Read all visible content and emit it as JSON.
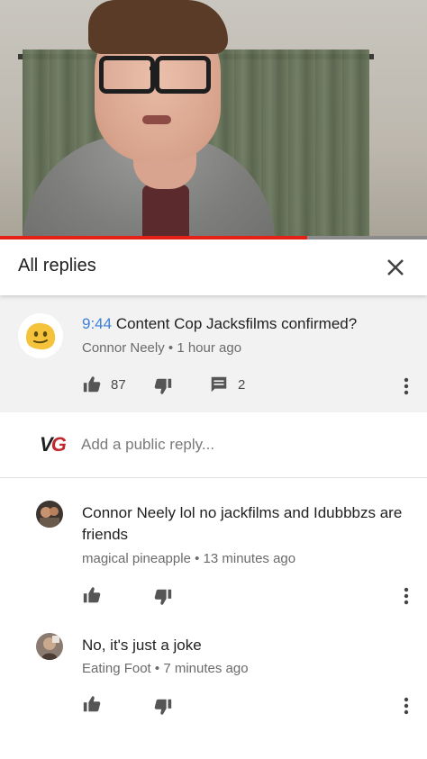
{
  "video": {
    "progress_fraction": 0.72
  },
  "header": {
    "title": "All replies",
    "close_icon": "close-icon"
  },
  "parent_comment": {
    "timestamp": "9:44",
    "text": " Content Cop Jacksfilms confirmed?",
    "author": "Connor Neely",
    "separator": "•",
    "time": "1 hour ago",
    "likes": "87",
    "replies": "2"
  },
  "add_reply": {
    "logo_v": "V",
    "logo_g": "G",
    "placeholder": "Add a public reply..."
  },
  "replies": [
    {
      "text": "Connor Neely lol no jackfilms and Idubbbzs are friends",
      "author": "magical pineapple",
      "separator": "•",
      "time": "13 minutes ago"
    },
    {
      "text": "No, it's just a joke",
      "author": "Eating Foot",
      "separator": "•",
      "time": "7 minutes ago"
    }
  ],
  "colors": {
    "accent_link": "#3e7fd6",
    "progress_red": "#e62117",
    "parent_bg": "#f2f2f2"
  }
}
